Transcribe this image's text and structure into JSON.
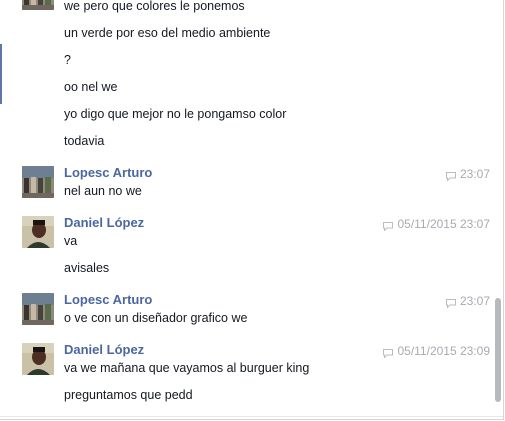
{
  "conversation": {
    "top_messages": [
      "we pero que colores le ponemos",
      "un verde por eso del medio ambiente",
      "?",
      "oo nel we",
      "yo digo que mejor no le pongamso color",
      "todavia"
    ],
    "groups": [
      {
        "sender": "Lopesc Arturo",
        "time": "23:07",
        "messages": [
          "nel aun no we"
        ]
      },
      {
        "sender": "Daniel López",
        "time": "05/11/2015 23:07",
        "messages": [
          "va",
          "avisales"
        ]
      },
      {
        "sender": "Lopesc Arturo",
        "time": "23:07",
        "messages": [
          "o ve con un diseñador grafico we"
        ]
      },
      {
        "sender": "Daniel López",
        "time": "05/11/2015 23:09",
        "messages": [
          "va we mañana que vayamos al burguer king",
          "preguntamos que pedd"
        ]
      }
    ]
  },
  "colors": {
    "sender_name": "#4b67a1",
    "timestamp": "#a7abb1",
    "message_text": "#141823",
    "scrollbar_thumb": "#b6b9bd"
  },
  "icons": {
    "timestamp": "speech-bubble-icon",
    "avatar_group": "group-photo-avatar",
    "avatar_person": "person-photo-avatar"
  }
}
